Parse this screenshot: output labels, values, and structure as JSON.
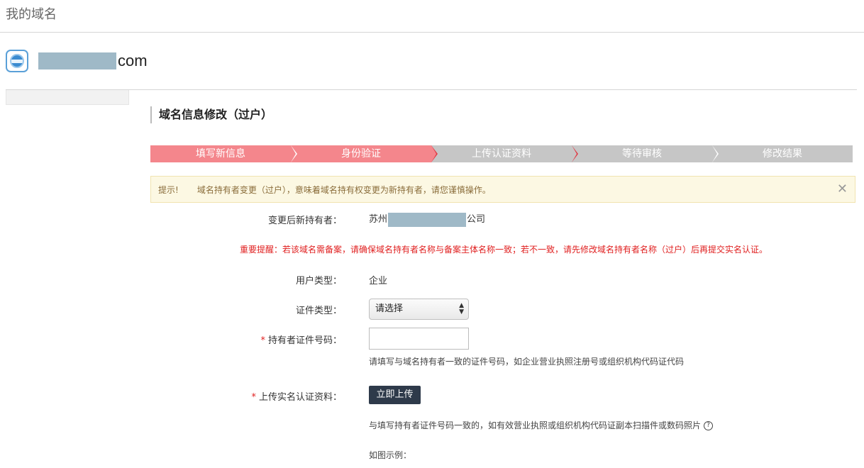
{
  "header": {
    "title": "我的域名"
  },
  "domain": {
    "suffix": "com"
  },
  "section": {
    "title": "域名信息修改（过户）"
  },
  "steps": [
    {
      "label": "填写新信息",
      "state": "done"
    },
    {
      "label": "身份验证",
      "state": "done"
    },
    {
      "label": "上传认证资料",
      "state": "todo"
    },
    {
      "label": "等待审核",
      "state": "todo"
    },
    {
      "label": "修改结果",
      "state": "todo"
    }
  ],
  "notice": {
    "label": "提示!",
    "text": "域名持有者变更（过户），意味着域名持有权变更为新持有者，请您谨慎操作。",
    "close": "✕"
  },
  "form": {
    "new_holder_label": "变更后新持有者：",
    "new_holder_prefix": "苏州",
    "new_holder_suffix": "公司",
    "warning": "重要提醒：若该域名需备案，请确保域名持有者名称与备案主体名称一致；若不一致，请先修改域名持有者名称（过户）后再提交实名认证。",
    "user_type_label": "用户类型：",
    "user_type_value": "企业",
    "cert_type_label": "证件类型：",
    "cert_type_selected": "请选择",
    "required_mark": "*",
    "cert_no_label": "持有者证件号码：",
    "cert_no_value": "",
    "cert_no_hint": "请填写与域名持有者一致的证件号码，如企业营业执照注册号或组织机构代码证代码",
    "upload_label": "上传实名认证资料：",
    "upload_button": "立即上传",
    "upload_hint": "与填写持有者证件号码一致的，如有效营业执照或组织机构代码证副本扫描件或数码照片",
    "help_glyph": "?",
    "example_label": "如图示例："
  },
  "colors": {
    "step_done": "#f4868c",
    "step_todo": "#c6c6c6",
    "warning_red": "#e02020",
    "button_dark": "#2e3a4a",
    "notice_bg": "#fcf8e3"
  },
  "icons": {
    "domain_icon": "www-globe-icon",
    "close": "close-icon",
    "help": "question-circle-icon",
    "select_arrows": "select-arrows-icon"
  }
}
